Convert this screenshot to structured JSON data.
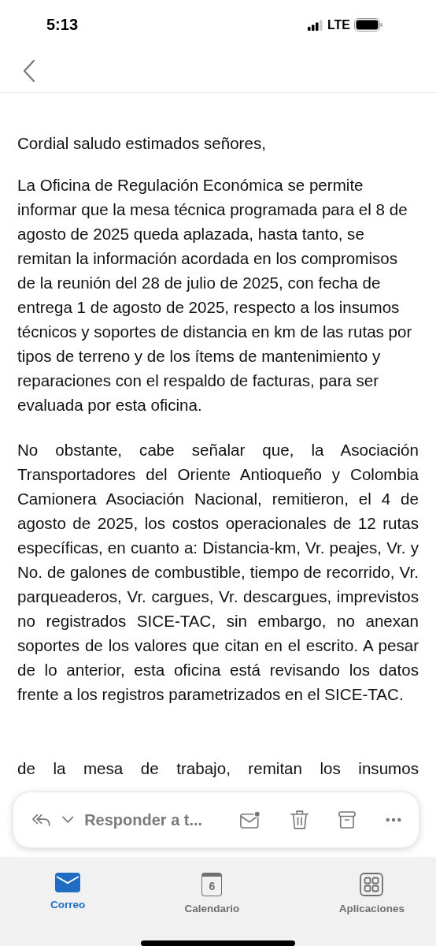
{
  "status_bar": {
    "time": "5:13",
    "network": "LTE"
  },
  "message": {
    "blocks": [
      {
        "kind": "greeting",
        "text": "Cordial saludo estimados señores,"
      },
      {
        "kind": "plain",
        "text": "La Oficina de Regulación Económica se permite informar que la mesa técnica programada para el 8 de agosto de 2025 queda aplazada, hasta tanto, se remitan la información acordada en los compromisos de la reunión del 28 de julio de 2025, con fecha de entrega 1 de agosto de 2025, respecto a los insumos técnicos y soportes de distancia en km de las rutas por tipos de terreno y de los ítems de mantenimiento y reparaciones con el respaldo de facturas, para ser evaluada por esta oficina."
      },
      {
        "kind": "justified",
        "text": "No obstante, cabe señalar que, la Asociación Transportadores del Oriente Antioqueño y Colombia Camionera Asociación Nacional, remitieron, el 4 de agosto de 2025, los costos operacionales de 12 rutas específicas, en cuanto a: Distancia-km, Vr. peajes, Vr. y No. de galones de combustible, tiempo de recorrido, Vr. parqueaderos, Vr. cargues, Vr. descargues, imprevistos no registrados SICE-TAC, sin embargo, no anexan soportes de los valores que citan en el escrito. A pesar de lo anterior, esta oficina está revisando los datos frente a los registros parametrizados en el SICE-TAC."
      }
    ],
    "partial_line": "de la mesa de trabajo, remitan los insumos"
  },
  "reply_bar": {
    "label": "Responder a t...",
    "unread_dot": true
  },
  "tabs": [
    {
      "label": "Correo",
      "kind": "mail",
      "selected": true
    },
    {
      "label": "Calendario",
      "kind": "calendar",
      "day": "6",
      "selected": false
    },
    {
      "label": "Aplicaciones",
      "kind": "apps",
      "selected": false
    }
  ]
}
